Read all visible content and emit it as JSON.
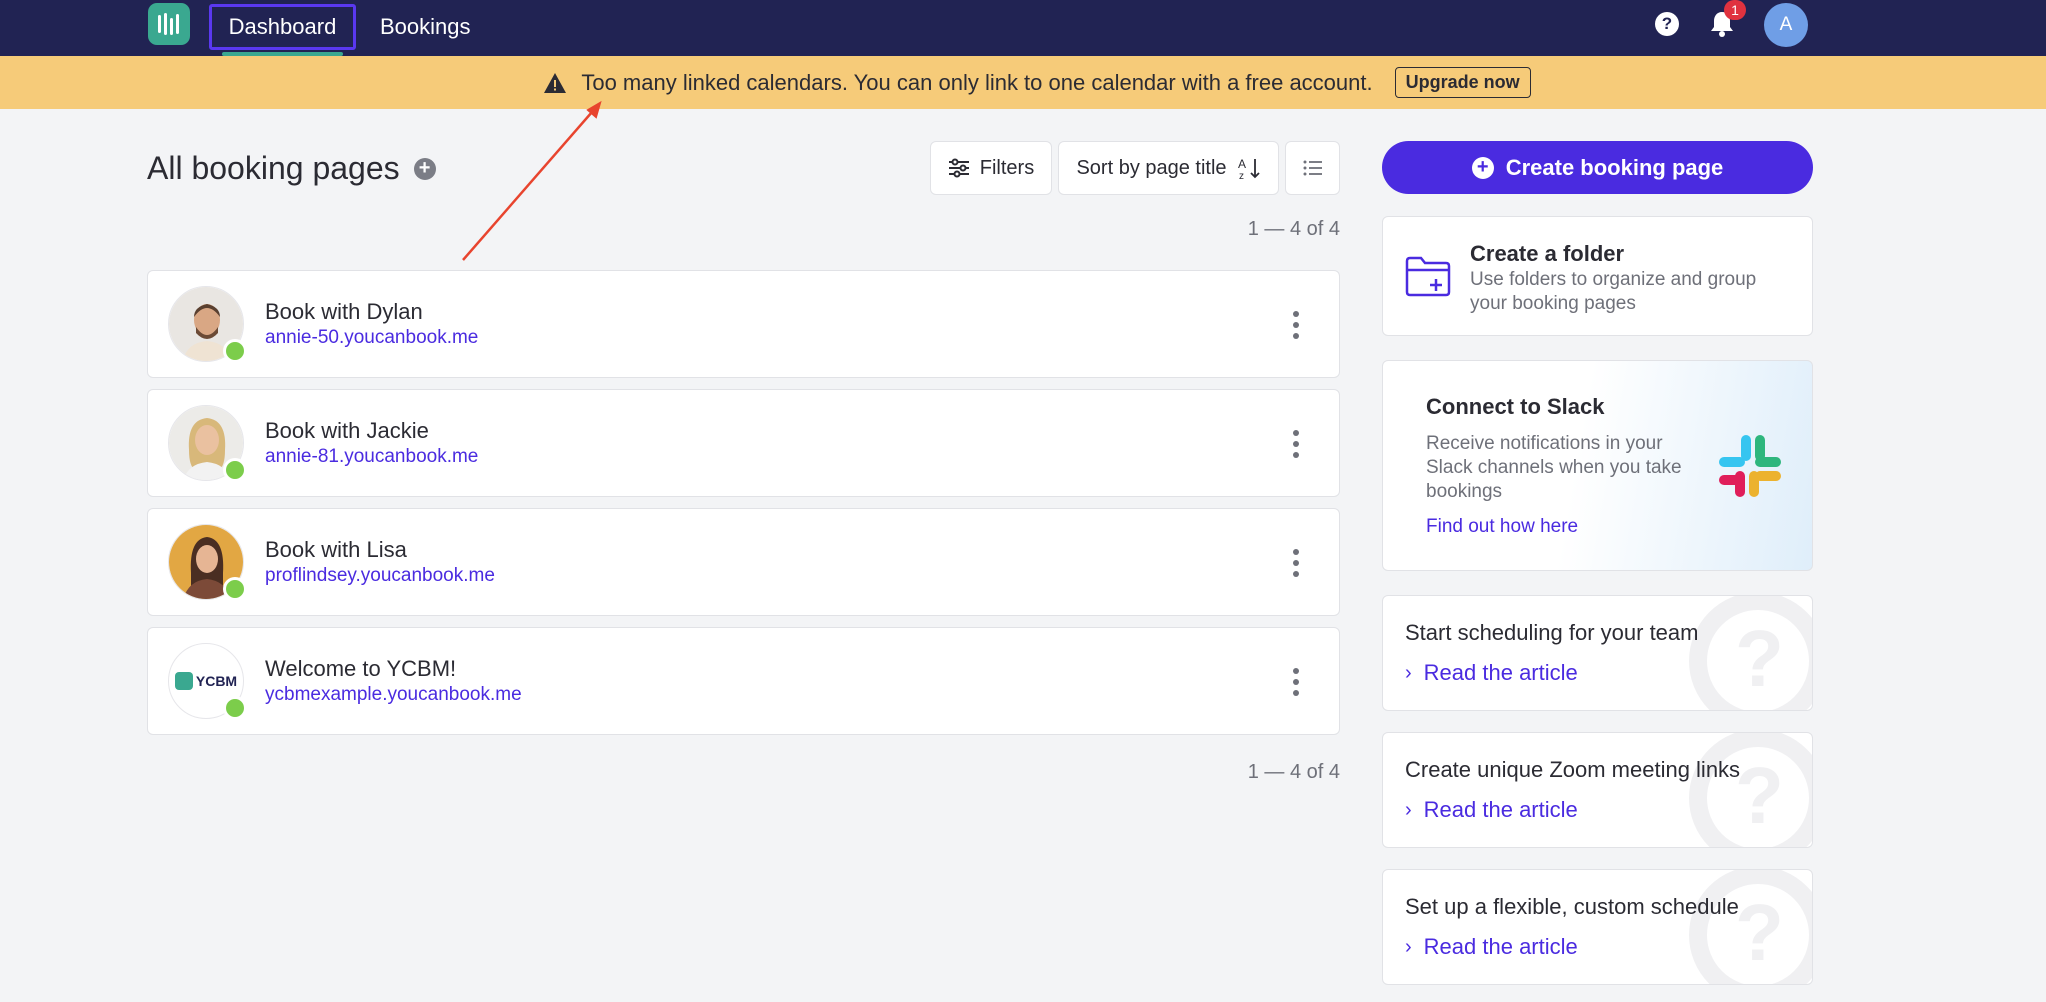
{
  "nav": {
    "tabs": [
      {
        "label": "Dashboard",
        "active": true
      },
      {
        "label": "Bookings",
        "active": false
      }
    ],
    "notification_count": "1",
    "user_initial": "A",
    "help_glyph": "?"
  },
  "banner": {
    "message": "Too many linked calendars. You can only link to one calendar with a free account.",
    "button_label": "Upgrade now",
    "icon": "warning-icon"
  },
  "main": {
    "title": "All booking pages",
    "filters_label": "Filters",
    "sort_label": "Sort by page title",
    "count_label": "1 — 4 of 4",
    "pages": [
      {
        "title": "Book with Dylan",
        "link": "annie-50.youcanbook.me"
      },
      {
        "title": "Book with Jackie",
        "link": "annie-81.youcanbook.me"
      },
      {
        "title": "Book with Lisa",
        "link": "proflindsey.youcanbook.me"
      },
      {
        "title": "Welcome to YCBM!",
        "link": "ycbmexample.youcanbook.me",
        "logo_text": "YCBM"
      }
    ]
  },
  "sidebar": {
    "create_label": "Create booking page",
    "folder": {
      "title": "Create a folder",
      "description": "Use folders to organize and group your booking pages"
    },
    "slack": {
      "title": "Connect to Slack",
      "description": "Receive notifications in your Slack channels when you take bookings",
      "link": "Find out how here"
    },
    "articles": [
      {
        "title": "Start scheduling for your team",
        "link": "Read the article"
      },
      {
        "title": "Create unique Zoom meeting links",
        "link": "Read the article"
      },
      {
        "title": "Set up a flexible, custom schedule",
        "link": "Read the article"
      }
    ]
  },
  "colors": {
    "nav_bg": "#212353",
    "banner_bg": "#f6cb79",
    "accent": "#4a2be0",
    "brand_green": "#3aa890",
    "status_green": "#7ccd4b",
    "annotation_arrow": "#e8442e"
  }
}
